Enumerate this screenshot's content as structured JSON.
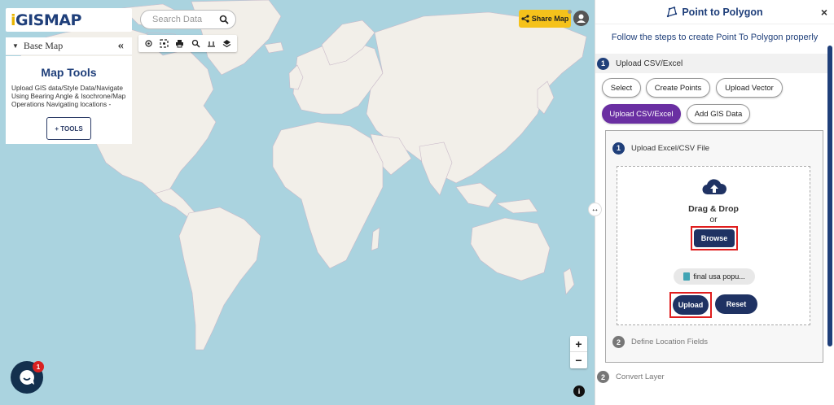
{
  "app": {
    "logo": "GISMAP",
    "logo_prefix": "i"
  },
  "search": {
    "placeholder": "Search Data"
  },
  "toolbar_icons": [
    "locate-icon",
    "target-icon",
    "print-icon",
    "search-icon",
    "measure-icon",
    "layers-icon"
  ],
  "base_map": {
    "label": "Base Map"
  },
  "map_tools": {
    "title": "Map Tools",
    "description": "Upload GIS data/Style Data/Navigate Using Bearing Angle & Isochrone/Map Operations Navigating locations -",
    "button": "+ TOOLS"
  },
  "share": {
    "label": "Share Map"
  },
  "zoom": {
    "in": "+",
    "out": "−"
  },
  "info": "i",
  "chat": {
    "badge": "1"
  },
  "panel": {
    "title": "Point to Polygon",
    "close": "×",
    "subtitle": "Follow the steps to create Point To Polygon properly",
    "step1": {
      "num": "1",
      "label": "Upload CSV/Excel"
    },
    "options": {
      "select": "Select",
      "create_points": "Create Points",
      "upload_vector": "Upload Vector",
      "upload_csv": "Upload CSV/Excel",
      "add_gis": "Add GIS Data"
    },
    "upload_file": {
      "num": "1",
      "label": "Upload Excel/CSV File",
      "drag_drop": "Drag & Drop",
      "or": "or",
      "browse": "Browse",
      "file_name": "final usa popu...",
      "upload": "Upload",
      "reset": "Reset"
    },
    "step2": {
      "num": "2",
      "label": "Define Location Fields"
    },
    "step3": {
      "num": "2",
      "label": "Convert Layer"
    }
  },
  "colors": {
    "ocean": "#aad3df",
    "land": "#f2efe9",
    "brand_navy": "#1f3263",
    "accent_purple": "#6a2fa2",
    "share_yellow": "#f5c21b",
    "highlight_red": "#e01e1e"
  }
}
